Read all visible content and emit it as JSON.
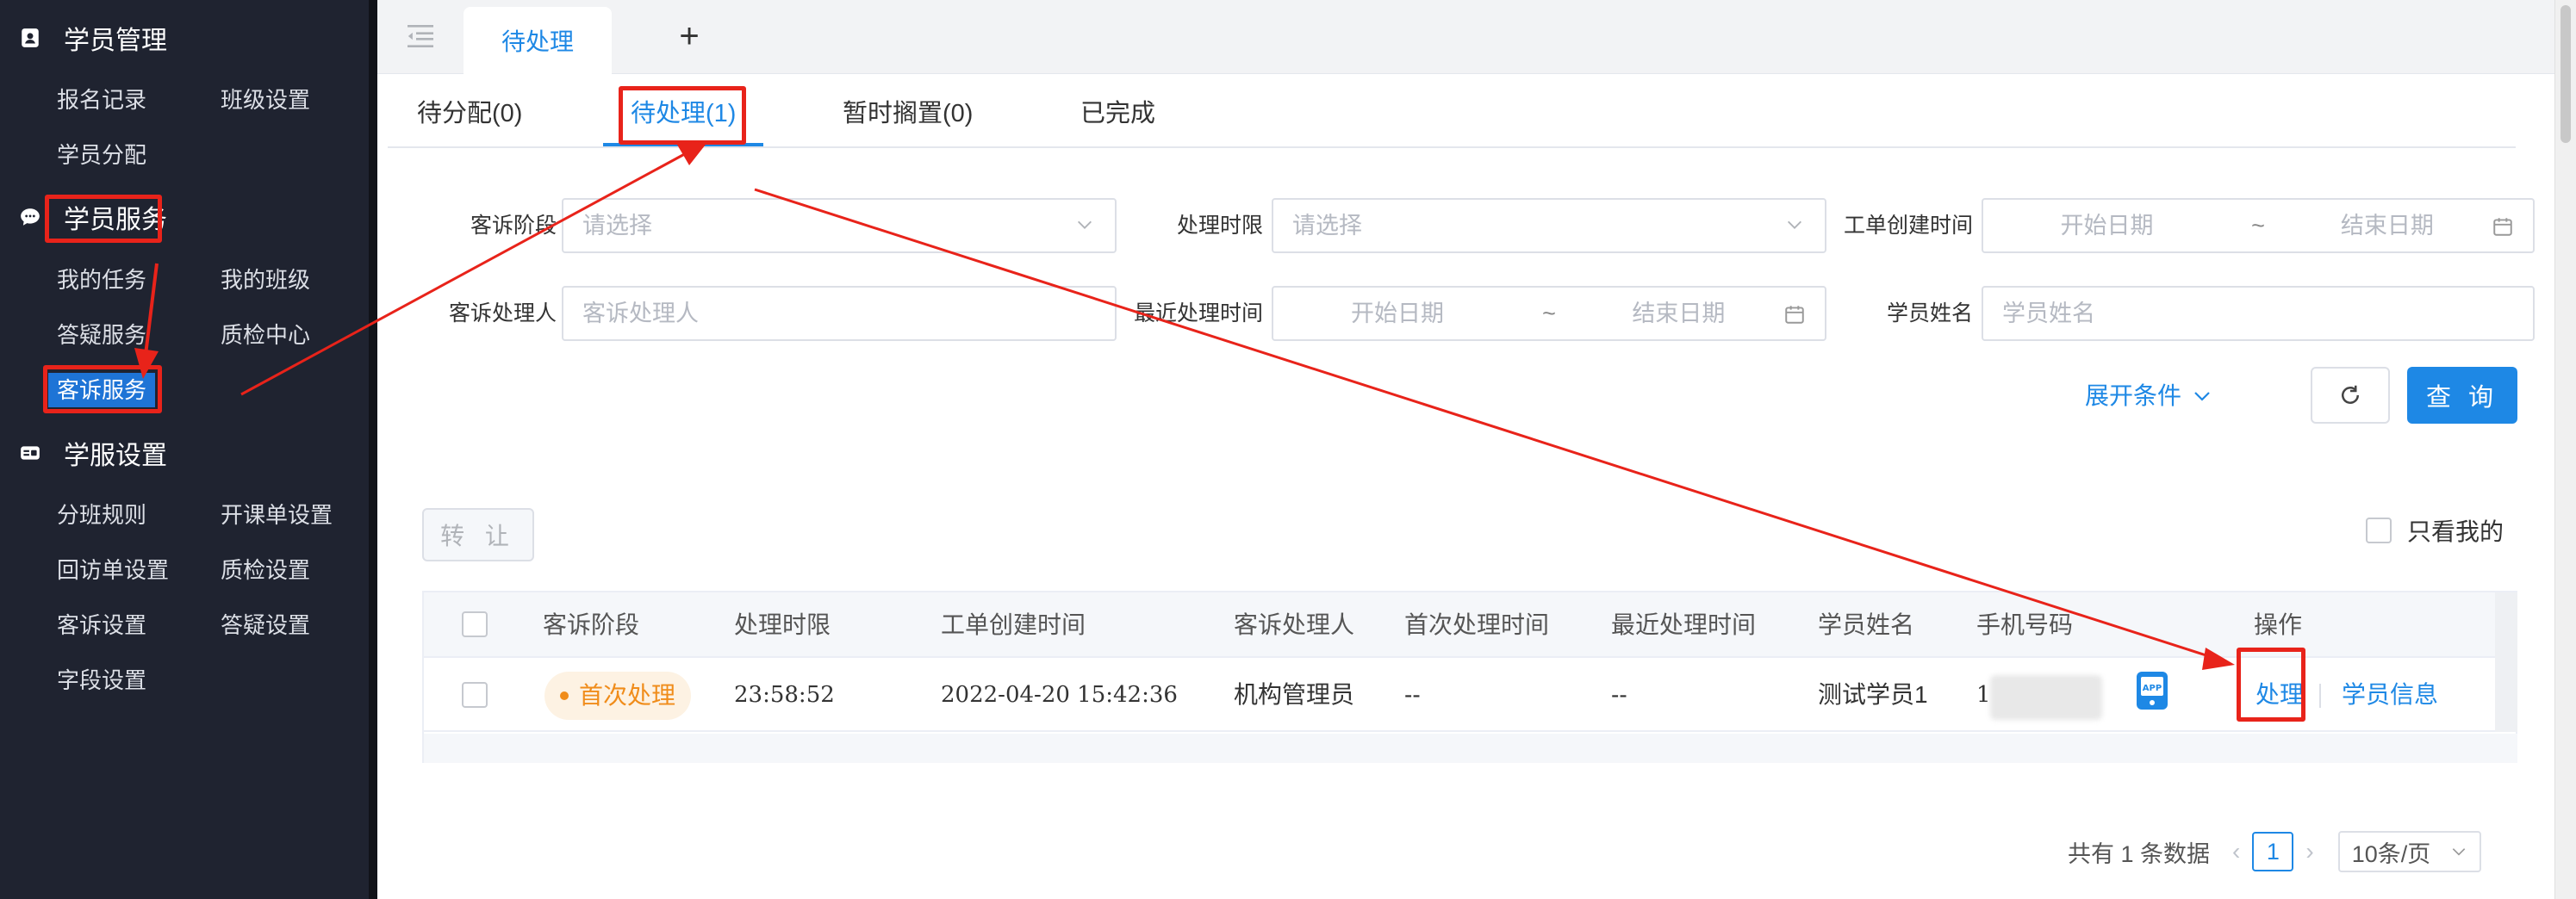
{
  "sidebar": {
    "sections": [
      {
        "title": "学员管理",
        "icon": "student-card-icon"
      },
      {
        "title": "学员服务",
        "icon": "chat-bubble-icon"
      },
      {
        "title": "学服设置",
        "icon": "settings-card-icon"
      }
    ],
    "items": {
      "enroll_records": "报名记录",
      "class_settings": "班级设置",
      "student_assign": "学员分配",
      "my_tasks": "我的任务",
      "my_classes": "我的班级",
      "qa_service": "答疑服务",
      "qc_center": "质检中心",
      "complaint_service": "客诉服务",
      "class_rules": "分班规则",
      "course_form_settings": "开课单设置",
      "visit_form_settings": "回访单设置",
      "qc_settings": "质检设置",
      "complaint_settings": "客诉设置",
      "qa_settings": "答疑设置",
      "field_settings": "字段设置"
    }
  },
  "topbar": {
    "active_tab": "待处理",
    "add_tab": "+"
  },
  "status_tabs": {
    "unassigned": "待分配(0)",
    "pending": "待处理(1)",
    "shelved": "暂时搁置(0)",
    "done": "已完成"
  },
  "filters": {
    "stage_label": "客诉阶段",
    "stage_placeholder": "请选择",
    "deadline_label": "处理时限",
    "deadline_placeholder": "请选择",
    "created_label": "工单创建时间",
    "handler_label": "客诉处理人",
    "handler_placeholder": "客诉处理人",
    "recent_label": "最近处理时间",
    "student_label": "学员姓名",
    "student_placeholder": "学员姓名",
    "start_date": "开始日期",
    "end_date": "结束日期",
    "range_sep": "~",
    "expand": "展开条件",
    "query": "查 询"
  },
  "toolbar": {
    "transfer": "转 让",
    "only_mine": "只看我的"
  },
  "table": {
    "headers": [
      "客诉阶段",
      "处理时限",
      "工单创建时间",
      "客诉处理人",
      "首次处理时间",
      "最近处理时间",
      "学员姓名",
      "手机号码",
      "操作"
    ],
    "row": {
      "stage": "首次处理",
      "deadline": "23:58:52",
      "created": "2022-04-20 15:42:36",
      "handler": "机构管理员",
      "first_time": "--",
      "recent_time": "--",
      "student": "测试学员1",
      "phone_prefix": "1",
      "app_label": "APP",
      "action_handle": "处理",
      "action_info": "学员信息"
    }
  },
  "pager": {
    "total": "共有 1 条数据",
    "page": "1",
    "size": "10条/页"
  },
  "colors": {
    "accent": "#1e88e5",
    "sidebar_bg": "#1f2330",
    "annotation_red": "#e8231a",
    "tag_orange": "#f08c1a"
  }
}
